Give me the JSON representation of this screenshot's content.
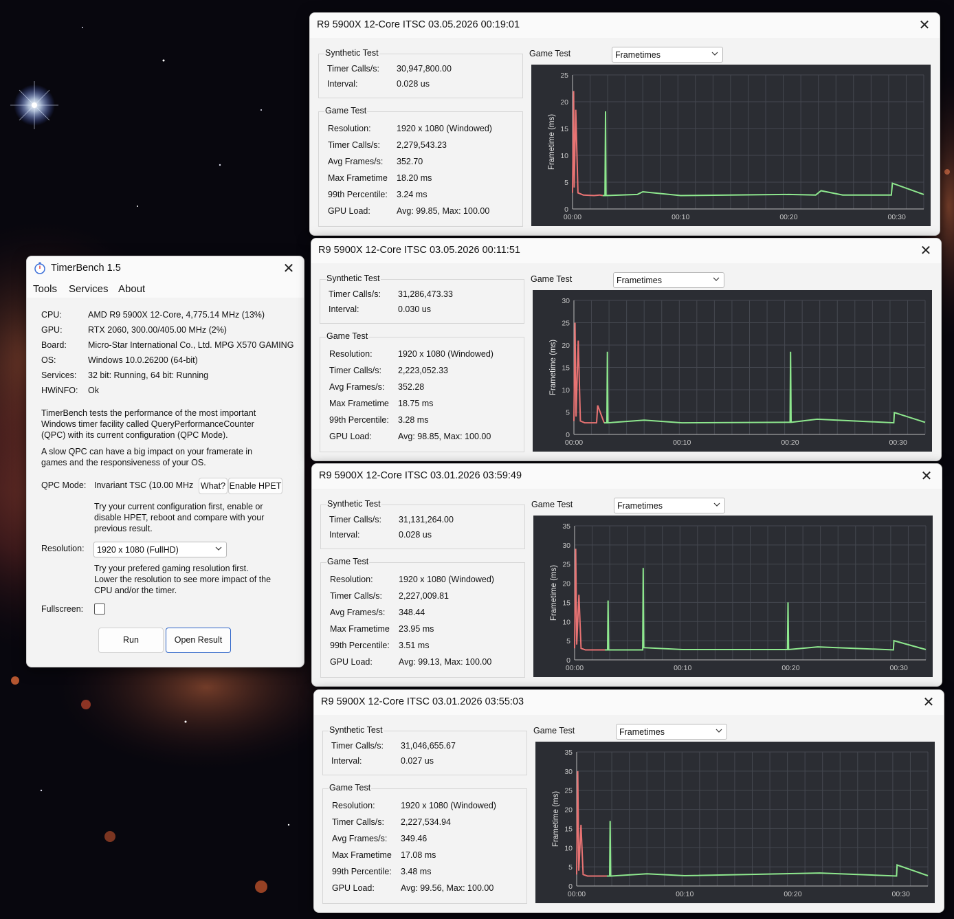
{
  "main": {
    "title": "TimerBench 1.5",
    "menu": [
      "Tools",
      "Services",
      "About"
    ],
    "info": [
      {
        "label": "CPU:",
        "value": "AMD R9 5900X 12-Core, 4,775.14 MHz (13%)"
      },
      {
        "label": "GPU:",
        "value": "RTX 2060, 300.00/405.00 MHz (2%)"
      },
      {
        "label": "Board:",
        "value": "Micro-Star International Co., Ltd. MPG X570 GAMING"
      },
      {
        "label": "OS:",
        "value": "Windows 10.0.26200 (64-bit)"
      },
      {
        "label": "Services:",
        "value": "32 bit: Running, 64 bit: Running"
      },
      {
        "label": "HWiNFO:",
        "value": "Ok"
      }
    ],
    "desc1": [
      "TimerBench tests the performance of the most important",
      "Windows timer facility called QueryPerformanceCounter",
      "(QPC) with its current configuration (QPC Mode)."
    ],
    "desc2": [
      "A slow QPC can have a big impact on your framerate in",
      "games and the responsiveness of your OS."
    ],
    "qpc_label": "QPC Mode:",
    "qpc_value": "Invariant TSC (10.00 MHz",
    "what_button": "What?",
    "hpet_button": "Enable HPET",
    "qpc_hint": [
      "Try your current configuration first, enable or",
      "disable HPET, reboot and compare with your",
      "previous result."
    ],
    "res_label": "Resolution:",
    "res_value": "1920 x 1080 (FullHD)",
    "res_hint": [
      "Try your prefered gaming resolution first.",
      "Lower the resolution to see more impact of the",
      "CPU and/or the timer."
    ],
    "fullscreen_label": "Fullscreen:",
    "run_button": "Run",
    "open_button": "Open Result"
  },
  "result_labels": {
    "synthetic": "Synthetic Test",
    "timer_calls": "Timer Calls/s:",
    "interval": "Interval:",
    "game": "Game Test",
    "resolution": "Resolution:",
    "avg_frames": "Avg Frames/s:",
    "max_frametime": "Max Frametime",
    "p99": "99th Percentile:",
    "gpu_load": "GPU Load:",
    "game_test": "Game Test",
    "combo": "Frametimes",
    "ylabel": "Frametime (ms)"
  },
  "results": [
    {
      "title": "R9 5900X 12-Core ITSC 03.05.2026 00:19:01",
      "syn_calls": "30,947,800.00",
      "syn_interval": "0.028 us",
      "resolution": "1920 x 1080 (Windowed)",
      "game_calls": "2,279,543.23",
      "avg_frames": "352.70",
      "max_frametime": "18.20 ms",
      "p99": "3.24 ms",
      "gpu_load": "Avg: 99.85, Max: 100.00"
    },
    {
      "title": "R9 5900X 12-Core ITSC 03.05.2026 00:11:51",
      "syn_calls": "31,286,473.33",
      "syn_interval": "0.030 us",
      "resolution": "1920 x 1080 (Windowed)",
      "game_calls": "2,223,052.33",
      "avg_frames": "352.28",
      "max_frametime": "18.75 ms",
      "p99": "3.28 ms",
      "gpu_load": "Avg: 98.85, Max: 100.00"
    },
    {
      "title": "R9 5900X 12-Core ITSC 03.01.2026 03:59:49",
      "syn_calls": "31,131,264.00",
      "syn_interval": "0.028 us",
      "resolution": "1920 x 1080 (Windowed)",
      "game_calls": "2,227,009.81",
      "avg_frames": "348.44",
      "max_frametime": "23.95 ms",
      "p99": "3.51 ms",
      "gpu_load": "Avg: 99.13, Max: 100.00"
    },
    {
      "title": "R9 5900X 12-Core ITSC 03.01.2026 03:55:03",
      "syn_calls": "31,046,655.67",
      "syn_interval": "0.027 us",
      "resolution": "1920 x 1080 (Windowed)",
      "game_calls": "2,227,534.94",
      "avg_frames": "349.46",
      "max_frametime": "17.08 ms",
      "p99": "3.48 ms",
      "gpu_load": "Avg: 99.56, Max: 100.00"
    }
  ],
  "chart_data": [
    {
      "type": "line",
      "ylabel": "Frametime (ms)",
      "xticks": [
        "00:00",
        "00:10",
        "00:20",
        "00:30"
      ],
      "yticks": [
        0,
        5,
        10,
        15,
        20,
        25
      ],
      "ylim": [
        0,
        25
      ],
      "xlim_s": [
        0,
        32.5
      ],
      "grid": true,
      "series": [
        {
          "color": "#e87373",
          "x": [
            0,
            0.1,
            0.15,
            0.3,
            0.5,
            1,
            2,
            2.5,
            2.8
          ],
          "y": [
            3,
            22,
            4,
            18.5,
            3,
            2.6,
            2.5,
            2.6,
            2.5
          ]
        },
        {
          "color": "#8ee88e",
          "x": [
            2.8,
            3.0,
            3.05,
            3.1,
            6,
            6.5,
            10,
            20,
            22.5,
            23,
            25,
            29.5,
            29.6,
            32.5
          ],
          "y": [
            2.5,
            2.5,
            18.2,
            2.5,
            2.7,
            3.2,
            2.5,
            2.7,
            2.6,
            3.4,
            2.6,
            2.6,
            4.8,
            2.7
          ]
        }
      ]
    },
    {
      "type": "line",
      "ylabel": "Frametime (ms)",
      "xticks": [
        "00:00",
        "00:10",
        "00:20",
        "00:30"
      ],
      "yticks": [
        0,
        5,
        10,
        15,
        20,
        25,
        30
      ],
      "ylim": [
        0,
        30
      ],
      "xlim_s": [
        0,
        32.5
      ],
      "grid": true,
      "series": [
        {
          "color": "#e87373",
          "x": [
            0,
            0.1,
            0.2,
            0.4,
            0.6,
            1,
            2.1,
            2.2,
            2.8
          ],
          "y": [
            3,
            25,
            4,
            21,
            3,
            2.6,
            2.6,
            6.5,
            2.6
          ]
        },
        {
          "color": "#8ee88e",
          "x": [
            2.8,
            3.05,
            3.1,
            3.15,
            6.5,
            10,
            20,
            20.05,
            20.1,
            22.5,
            29.6,
            29.65,
            32.5
          ],
          "y": [
            2.6,
            2.6,
            18.5,
            2.6,
            3.2,
            2.6,
            2.7,
            18.5,
            2.7,
            3.4,
            2.6,
            4.9,
            2.7
          ]
        }
      ]
    },
    {
      "type": "line",
      "ylabel": "Frametime (ms)",
      "xticks": [
        "00:00",
        "00:10",
        "00:20",
        "00:30"
      ],
      "yticks": [
        0,
        5,
        10,
        15,
        20,
        25,
        30,
        35
      ],
      "ylim": [
        0,
        35
      ],
      "xlim_s": [
        0,
        32.5
      ],
      "grid": true,
      "series": [
        {
          "color": "#e87373",
          "x": [
            0,
            0.1,
            0.2,
            0.4,
            0.6,
            1,
            2.8
          ],
          "y": [
            3,
            29,
            4,
            17,
            3,
            2.6,
            2.6
          ]
        },
        {
          "color": "#8ee88e",
          "x": [
            2.8,
            3.05,
            3.1,
            3.15,
            6.3,
            6.35,
            6.4,
            10,
            19.7,
            19.75,
            19.8,
            22.5,
            29.5,
            29.55,
            32.5
          ],
          "y": [
            2.6,
            2.6,
            15.5,
            2.6,
            2.6,
            24,
            3.2,
            2.7,
            2.7,
            15,
            2.7,
            3.4,
            2.6,
            5,
            2.7
          ]
        }
      ]
    },
    {
      "type": "line",
      "ylabel": "Frametime (ms)",
      "xticks": [
        "00:00",
        "00:10",
        "00:20",
        "00:30"
      ],
      "yticks": [
        0,
        5,
        10,
        15,
        20,
        25,
        30,
        35
      ],
      "ylim": [
        0,
        35
      ],
      "xlim_s": [
        0,
        32.5
      ],
      "grid": true,
      "series": [
        {
          "color": "#e87373",
          "x": [
            0,
            0.1,
            0.2,
            0.4,
            0.6,
            1,
            2.8
          ],
          "y": [
            3,
            30,
            4,
            16,
            3,
            2.6,
            2.6
          ]
        },
        {
          "color": "#8ee88e",
          "x": [
            2.8,
            3.05,
            3.1,
            3.15,
            6.5,
            10,
            22.5,
            29.6,
            29.65,
            32.5
          ],
          "y": [
            2.6,
            2.6,
            17,
            2.6,
            3.2,
            2.7,
            3.4,
            2.6,
            5.5,
            2.7
          ]
        }
      ]
    }
  ]
}
